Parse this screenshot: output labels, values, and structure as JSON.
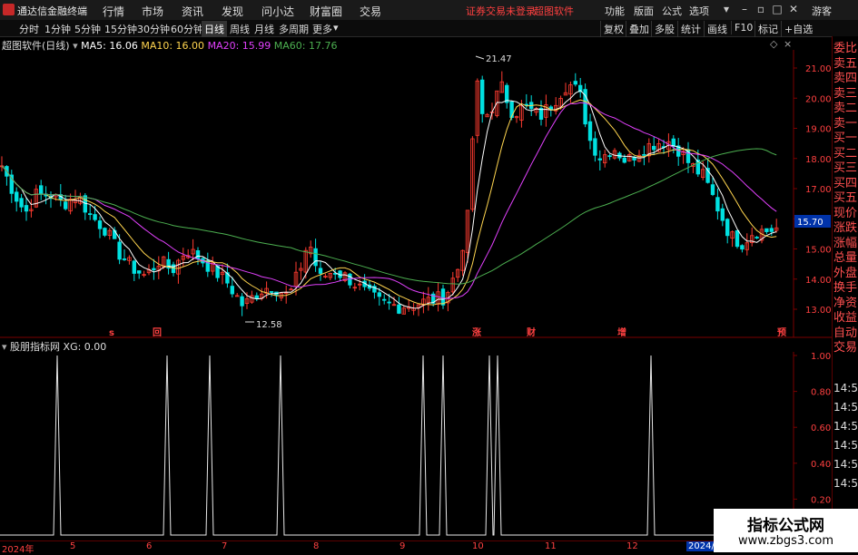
{
  "app_title": "通达信金融终端",
  "menu": [
    "行情",
    "市场",
    "资讯",
    "发现",
    "问小达",
    "财富圈",
    "交易"
  ],
  "top_links": [
    "证券交易未登录",
    "超图软件"
  ],
  "top_right": [
    "功能",
    "版面",
    "公式",
    "选项"
  ],
  "guest": "游客",
  "periods": [
    "分时",
    "1分钟",
    "5分钟",
    "15分钟",
    "30分钟",
    "60分钟",
    "日线",
    "周线",
    "月线",
    "多周期",
    "更多"
  ],
  "active_period": "日线",
  "right_tools": [
    "复权",
    "叠加",
    "多股",
    "统计",
    "画线",
    "F10",
    "标记",
    "+自选"
  ],
  "legend": {
    "name": "超图软件(日线)",
    "ma5": "MA5: 16.06",
    "ma10": "MA10: 16.00",
    "ma20": "MA20: 15.99",
    "ma60": "MA60: 17.76"
  },
  "colors": {
    "ma5": "#ffffff",
    "ma10": "#ffd54f",
    "ma20": "#e040fb",
    "ma60": "#4caf50",
    "up": "#ff3b30",
    "down": "#00e0e0",
    "axis_red": "#ff4040"
  },
  "price_axis": [
    "21.00",
    "20.00",
    "19.00",
    "18.00",
    "17.00",
    "16.00",
    "15.00",
    "14.00",
    "13.00"
  ],
  "price_box": "15.70",
  "high_label": "21.47",
  "low_label": "12.58",
  "markers": [
    "s",
    "回",
    "涨",
    "财",
    "增",
    "预"
  ],
  "sub_legend": {
    "name": "股朋指标网",
    "value": "XG: 0.00"
  },
  "sub_axis": [
    "1.00",
    "0.80",
    "0.60",
    "0.40",
    "0.20"
  ],
  "sidebar": [
    "委比",
    "卖五",
    "卖四",
    "卖三",
    "卖二",
    "卖一",
    "买一",
    "买二",
    "买三",
    "买四",
    "买五",
    "现价",
    "涨跌",
    "涨幅",
    "总量",
    "外盘",
    "换手",
    "净资",
    "收益",
    "自动",
    "交易"
  ],
  "side_times": [
    "14:56",
    "14:56",
    "14:56",
    "14:56",
    "14:56",
    "14:56"
  ],
  "dates": [
    "2024年",
    "5",
    "6",
    "7",
    "8",
    "9",
    "10",
    "11",
    "12",
    "2024/1"
  ],
  "watermark": {
    "line1": "指标公式网",
    "line2": "www.zbgs3.com"
  },
  "icons": [
    "close-icon",
    "settings-icon",
    "dropdown-icon",
    "minimize-icon",
    "maximize-icon"
  ],
  "chart_data": {
    "type": "candlestick",
    "y_range": [
      12.5,
      21.8
    ],
    "ma5_last": 16.06,
    "ma10_last": 16.0,
    "ma20_last": 15.99,
    "ma60_last": 17.76,
    "high": 21.47,
    "low": 12.58,
    "indicator_spikes": [
      63,
      184,
      231,
      309,
      466,
      488,
      539,
      548,
      717
    ]
  }
}
